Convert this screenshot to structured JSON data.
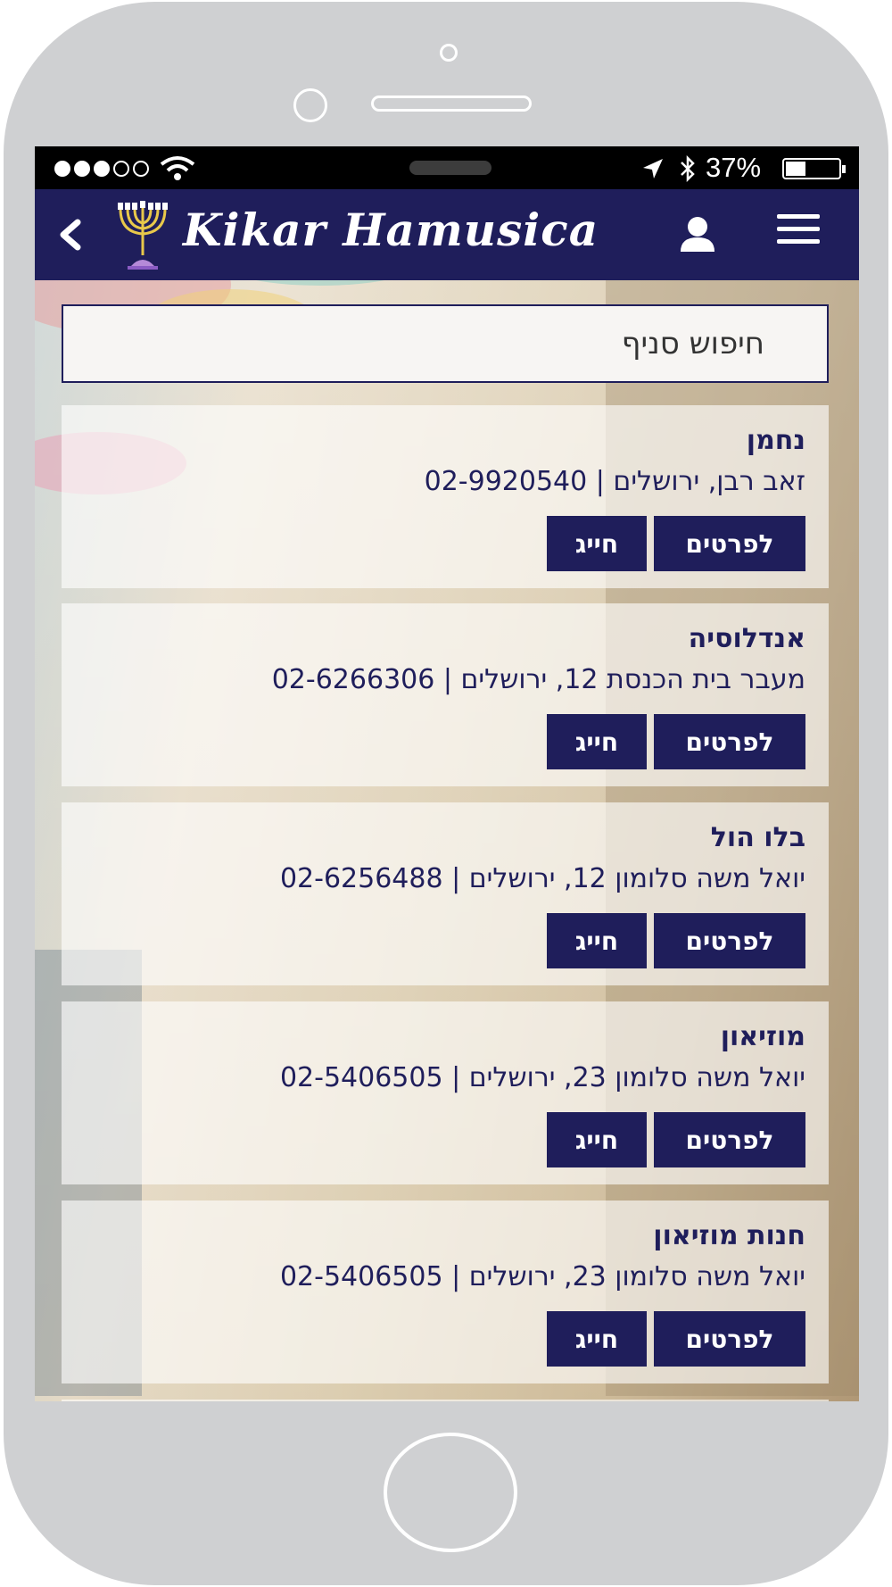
{
  "status_bar": {
    "battery_percent": "37%",
    "signal_bars_filled": 3,
    "signal_bars_total": 5,
    "battery_level": 0.37
  },
  "header": {
    "title": "Kikar Hamusica",
    "back_icon": "chevron-left-icon",
    "logo_icon": "menorah-icon",
    "user_icon": "user-icon",
    "menu_icon": "hamburger-menu-icon"
  },
  "search": {
    "placeholder": "חיפוש סניף",
    "value": ""
  },
  "branches": [
    {
      "name": "נחמן",
      "info": "זאב רבן, ירושלים | 02-9920540",
      "details_label": "לפרטים",
      "call_label": "חייג"
    },
    {
      "name": "אנדלוסיה",
      "info": "מעבר בית הכנסת 12, ירושלים | 02-6266306",
      "details_label": "לפרטים",
      "call_label": "חייג"
    },
    {
      "name": "בלו הול",
      "info": "יואל משה סלומון 12, ירושלים | 02-6256488",
      "details_label": "לפרטים",
      "call_label": "חייג"
    },
    {
      "name": "מוזיאון",
      "info": "יואל משה סלומון 23, ירושלים | 02-5406505",
      "details_label": "לפרטים",
      "call_label": "חייג"
    },
    {
      "name": "חנות מוזיאון",
      "info": "יואל משה סלומון 23, ירושלים | 02-5406505",
      "details_label": "לפרטים",
      "call_label": "חייג"
    }
  ],
  "colors": {
    "brand_navy": "#1f1e5b",
    "device_gray": "#cfd0d2"
  }
}
